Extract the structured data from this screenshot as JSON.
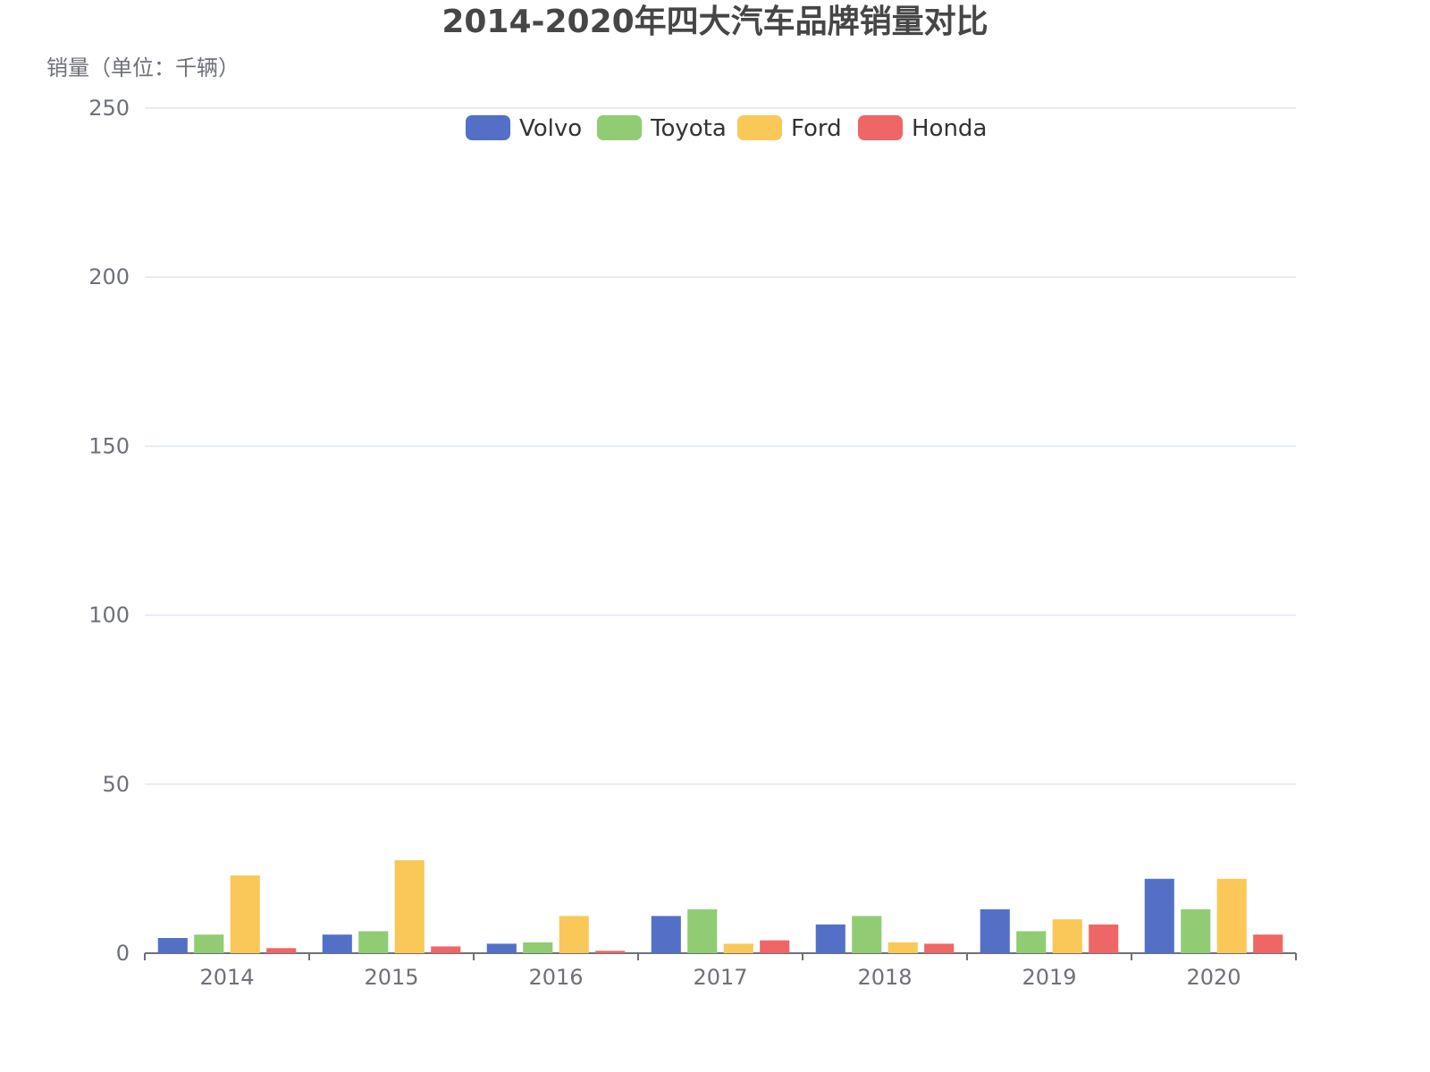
{
  "chart_data": {
    "type": "bar",
    "title": "2014-2020年四大汽车品牌销量对比",
    "ylabel": "销量（单位：千辆）",
    "xlabel": "",
    "categories": [
      "2014",
      "2015",
      "2016",
      "2017",
      "2018",
      "2019",
      "2020"
    ],
    "ylim": [
      0,
      250
    ],
    "yticks": [
      0,
      50,
      100,
      150,
      200,
      250
    ],
    "grid": true,
    "legend_position": "top-center",
    "series": [
      {
        "name": "Volvo",
        "color": "#5470c6",
        "values": [
          4.5,
          5.5,
          2.8,
          11,
          8.5,
          13,
          22
        ]
      },
      {
        "name": "Toyota",
        "color": "#91cc75",
        "values": [
          5.5,
          6.5,
          3.2,
          13,
          11,
          6.5,
          13
        ]
      },
      {
        "name": "Ford",
        "color": "#fac858",
        "values": [
          23,
          27.5,
          11,
          2.8,
          3.2,
          10,
          22
        ]
      },
      {
        "name": "Honda",
        "color": "#ee6666",
        "values": [
          1.5,
          2,
          0.7,
          3.8,
          2.8,
          8.5,
          5.5
        ]
      }
    ]
  }
}
